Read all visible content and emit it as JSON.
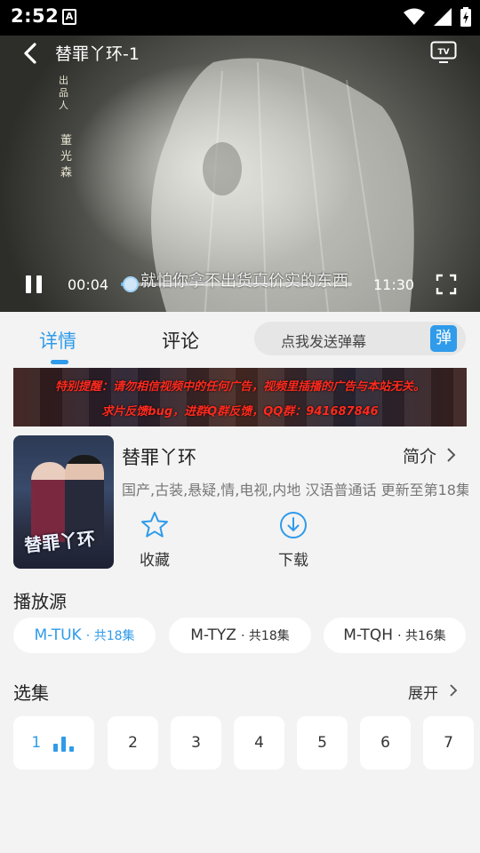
{
  "status_bar": {
    "time": "2:52",
    "notification_icon": "A"
  },
  "player": {
    "title": "替罪丫环-1",
    "overlay_text_1": "出品人",
    "overlay_text_2": "董光森",
    "subtitle": "就怕你拿不出货真价实的东西",
    "current_time": "00:04",
    "total_time": "11:30",
    "progress": 0.006,
    "icons": [
      "back-arrow-icon",
      "tv-cast-icon",
      "pause-icon",
      "fullscreen-icon"
    ]
  },
  "tabs": [
    {
      "label": "详情",
      "active": true
    },
    {
      "label": "评论",
      "active": false
    }
  ],
  "danmaku": {
    "placeholder": "点我发送弹幕",
    "button_label": "弹"
  },
  "ad_banner": {
    "line1": "特别提醒：请勿相信视频中的任何广告，视频里插播的广告与本站无关。",
    "line2": "求片反馈bug，进群Q群反馈，QQ群：941687846"
  },
  "show": {
    "title": "替罪丫环",
    "intro_label": "简介",
    "tags": "国产,古装,悬疑,情,电视,内地 汉语普通话 更新至第18集",
    "poster_text": "替罪丫环"
  },
  "actions": {
    "favorite_label": "收藏",
    "download_label": "下载"
  },
  "sources": {
    "title": "播放源",
    "items": [
      {
        "name": "M-TUK",
        "count": "· 共18集",
        "active": true
      },
      {
        "name": "M-TYZ",
        "count": "· 共18集",
        "active": false
      },
      {
        "name": "M-TQH",
        "count": "· 共16集",
        "active": false
      }
    ]
  },
  "episodes": {
    "title": "选集",
    "expand_label": "展开",
    "items": [
      "1",
      "2",
      "3",
      "4",
      "5",
      "6",
      "7"
    ],
    "playing": "1"
  },
  "colors": {
    "accent": "#2f9bea",
    "ad_text": "#ff2a1e",
    "background": "#f3f3f3"
  }
}
